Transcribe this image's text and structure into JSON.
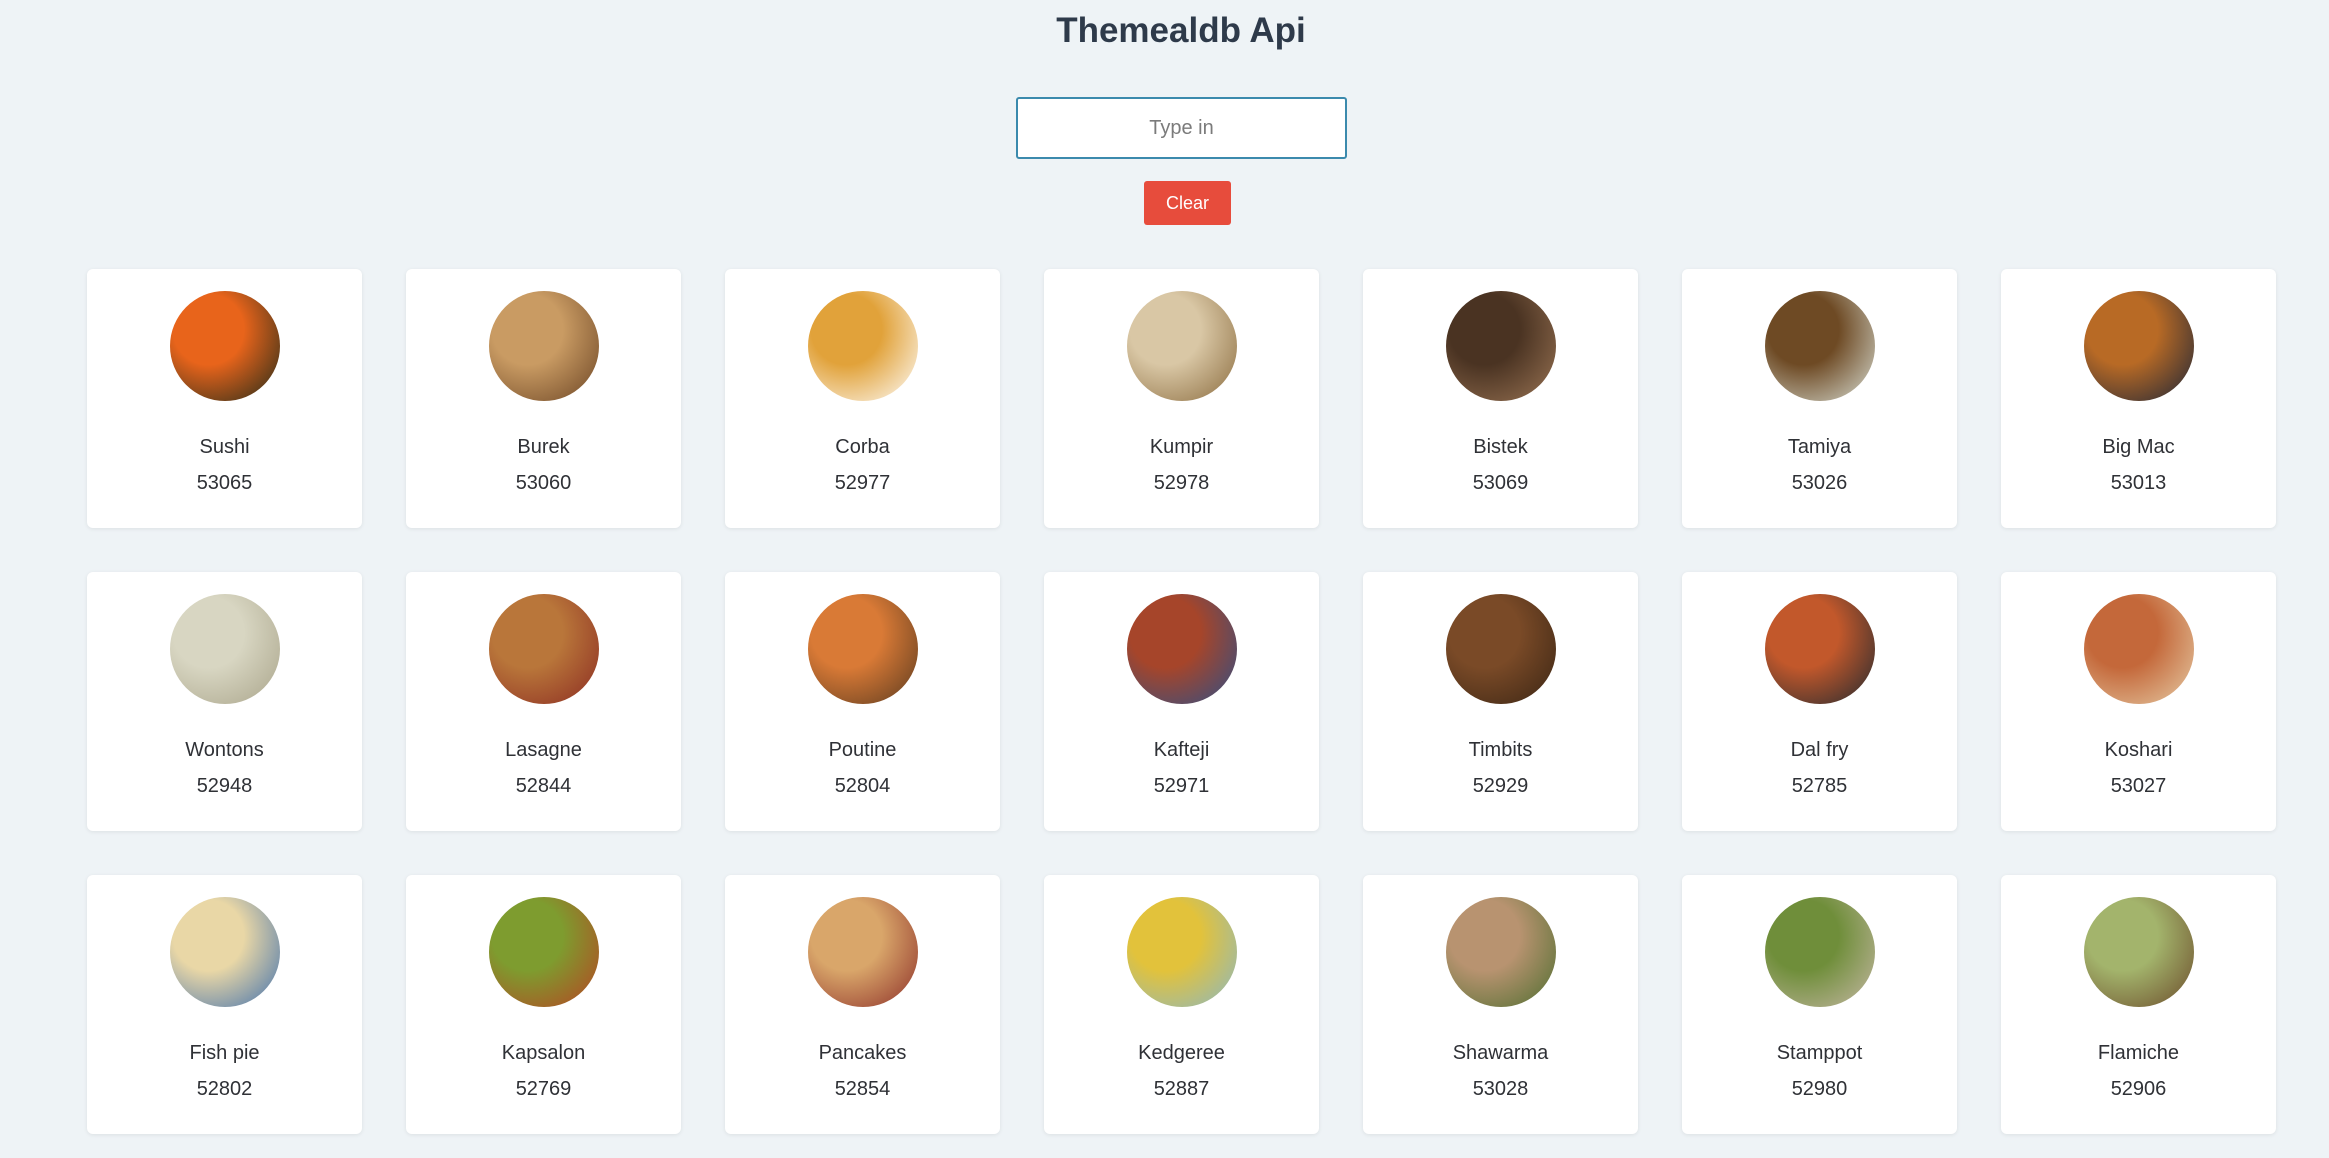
{
  "header": {
    "title": "Themealdb Api"
  },
  "search": {
    "placeholder": "Type in",
    "value": ""
  },
  "clear_button": {
    "label": "Clear"
  },
  "meals": [
    {
      "name": "Sushi",
      "id": "53065",
      "colors": [
        "#e8641b",
        "#1e2a1a"
      ]
    },
    {
      "name": "Burek",
      "id": "53060",
      "colors": [
        "#c99b63",
        "#6b4424"
      ]
    },
    {
      "name": "Corba",
      "id": "52977",
      "colors": [
        "#e1a23a",
        "#ffffff"
      ]
    },
    {
      "name": "Kumpir",
      "id": "52978",
      "colors": [
        "#d9c7a5",
        "#8a6b3e"
      ]
    },
    {
      "name": "Bistek",
      "id": "53069",
      "colors": [
        "#4a3322",
        "#9a7454"
      ]
    },
    {
      "name": "Tamiya",
      "id": "53026",
      "colors": [
        "#6e4a24",
        "#d9dfd5"
      ]
    },
    {
      "name": "Big Mac",
      "id": "53013",
      "colors": [
        "#b86a25",
        "#1a2438"
      ]
    },
    {
      "name": "Wontons",
      "id": "52948",
      "colors": [
        "#d8d6c2",
        "#a9a48a"
      ]
    },
    {
      "name": "Lasagne",
      "id": "52844",
      "colors": [
        "#b9763a",
        "#8b2b22"
      ]
    },
    {
      "name": "Poutine",
      "id": "52804",
      "colors": [
        "#d97a36",
        "#5a3a1f"
      ]
    },
    {
      "name": "Kafteji",
      "id": "52971",
      "colors": [
        "#a6452a",
        "#2d4f86"
      ]
    },
    {
      "name": "Timbits",
      "id": "52929",
      "colors": [
        "#7a4a27",
        "#3a2514"
      ]
    },
    {
      "name": "Dal fry",
      "id": "52785",
      "colors": [
        "#c2582b",
        "#1f2930"
      ]
    },
    {
      "name": "Koshari",
      "id": "53027",
      "colors": [
        "#c4683a",
        "#e6cda7"
      ]
    },
    {
      "name": "Fish pie",
      "id": "52802",
      "colors": [
        "#e9d7a6",
        "#3f6fae"
      ]
    },
    {
      "name": "Kapsalon",
      "id": "52769",
      "colors": [
        "#7e9c2f",
        "#b74222"
      ]
    },
    {
      "name": "Pancakes",
      "id": "52854",
      "colors": [
        "#d9a66a",
        "#8c2e28"
      ]
    },
    {
      "name": "Kedgeree",
      "id": "52887",
      "colors": [
        "#e2c23b",
        "#89b8c6"
      ]
    },
    {
      "name": "Shawarma",
      "id": "53028",
      "colors": [
        "#b89370",
        "#4d6d2f"
      ]
    },
    {
      "name": "Stamppot",
      "id": "52980",
      "colors": [
        "#6f8e3a",
        "#c7b8a6"
      ]
    },
    {
      "name": "Flamiche",
      "id": "52906",
      "colors": [
        "#a3b46c",
        "#6b4a2a"
      ]
    }
  ]
}
